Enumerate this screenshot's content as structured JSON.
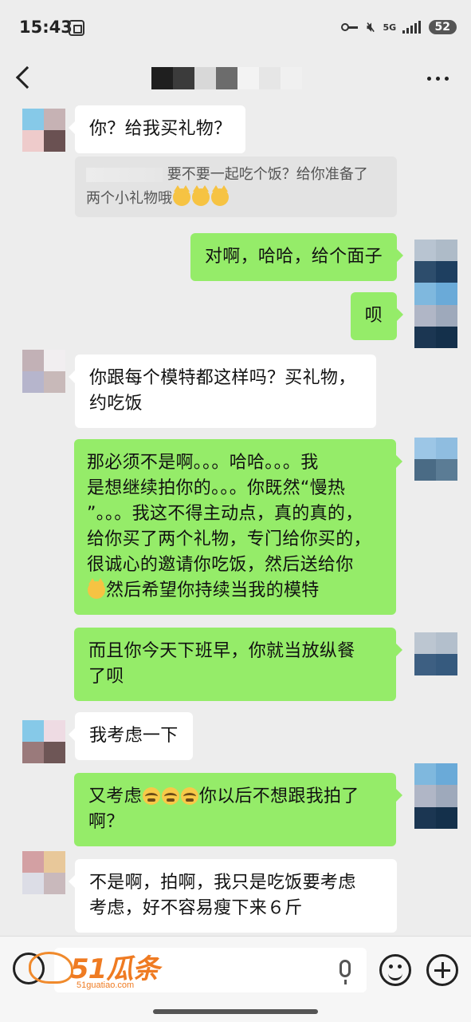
{
  "status_bar": {
    "time": "15:43",
    "network": "5G",
    "battery": "52"
  },
  "nav": {
    "contact_name": "",
    "more_icon": "more-dots-icon",
    "back_icon": "back-chevron-icon"
  },
  "messages": [
    {
      "side": "in",
      "text": "你？给我买礼物？"
    },
    {
      "side": "quote",
      "text": "要不要一起吃个饭？给你准备了两个小礼物哦"
    },
    {
      "side": "out",
      "text": "对啊，哈哈，给个面子"
    },
    {
      "side": "out",
      "text": "呗"
    },
    {
      "side": "in",
      "text": "你跟每个模特都这样吗？买礼物，约吃饭"
    },
    {
      "side": "out",
      "text": "那必须不是啊。。。哈哈。。。我是想继续拍你的。。。你既然“慢热”。。。我这不得主动点，真的真的，给你买了两个礼物，专门给你买的，很诚心的邀请你吃饭，然后送给你然后希望你持续当我的模特"
    },
    {
      "side": "out",
      "text": "而且你今天下班早，你就当放纵餐了呗"
    },
    {
      "side": "in",
      "text": "我考虑一下"
    },
    {
      "side": "out",
      "text": "又考虑你以后不想跟我拍了啊？"
    },
    {
      "side": "in",
      "text": "不是啊，拍啊，我只是吃饭要考虑考虑，好不容易瘦下来６斤"
    }
  ],
  "message_lines": {
    "m1": [
      "你？给我买礼物？"
    ],
    "quote": [
      "要不要一起吃个饭？给你准备了",
      "两个小礼物哦"
    ],
    "m3": [
      "对啊，哈哈，给个面子"
    ],
    "m4": [
      "呗"
    ],
    "m5": [
      "你跟每个模特都这样吗？买礼物，",
      "约吃饭"
    ],
    "m6": [
      "那必须不是啊。。。哈哈。。。我",
      "是想继续拍你的。。。你既然“慢热",
      "”。。。我这不得主动点，真的真的，",
      "给你买了两个礼物，专门给你买的，",
      "很诚心的邀请你吃饭，然后送给你",
      "然后希望你持续当我的模特"
    ],
    "m7": [
      "而且你今天下班早，你就当放纵餐",
      "了呗"
    ],
    "m8": [
      "我考虑一下"
    ],
    "m9": [
      "又考虑",
      "你以后不想跟我拍了",
      "啊？"
    ],
    "m10": [
      "不是啊，拍啊，我只是吃饭要考虑",
      "考虑，好不容易瘦下来６斤"
    ]
  },
  "input_bar": {
    "placeholder": "",
    "icons": [
      "voice-toggle-icon",
      "mic-icon",
      "emoji-icon",
      "plus-icon"
    ]
  },
  "watermark": {
    "main": "51瓜条",
    "sub": "51guatiao.com"
  },
  "colors": {
    "background": "#ededed",
    "incoming_bubble": "#ffffff",
    "outgoing_bubble": "#95ec69",
    "watermark": "#ef7b22"
  }
}
